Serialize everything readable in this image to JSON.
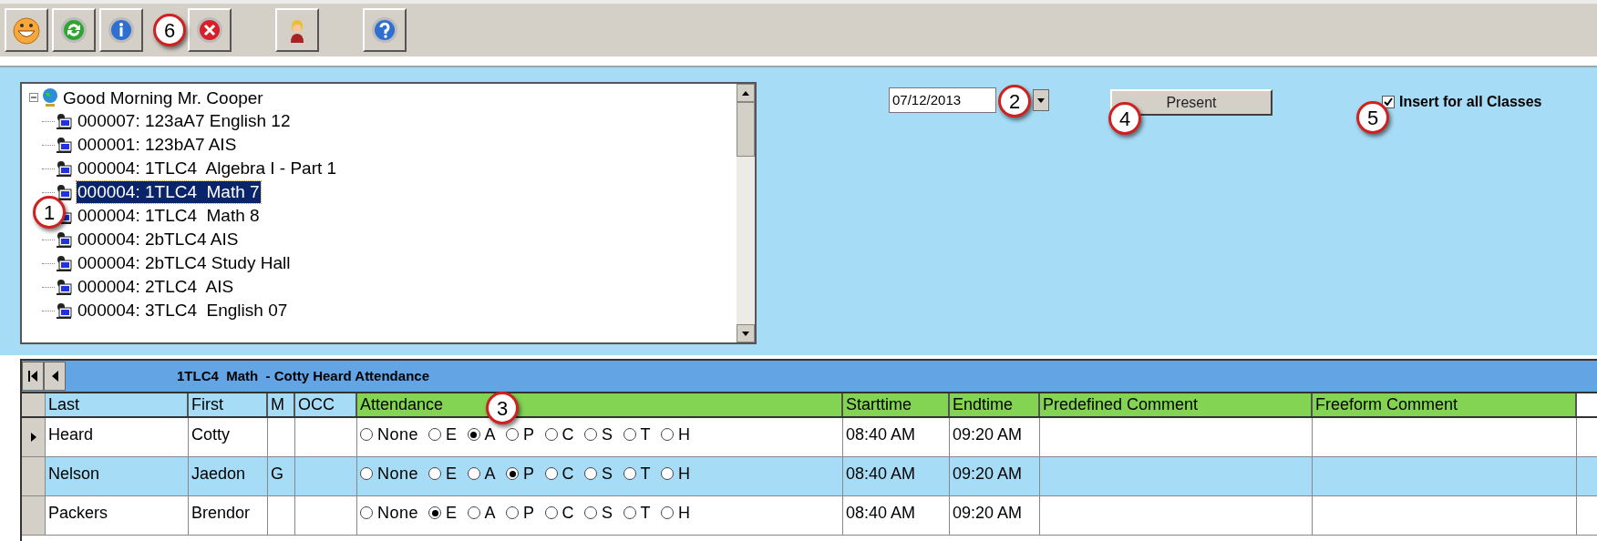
{
  "toolbar": {
    "buttons": [
      {
        "kind": "smiley"
      },
      {
        "kind": "refresh"
      },
      {
        "kind": "info"
      },
      {
        "kind": "close"
      },
      {
        "kind": "person"
      },
      {
        "kind": "help"
      }
    ]
  },
  "tree": {
    "root": {
      "label": "Good Morning Mr. Cooper",
      "expanded": true,
      "children": [
        {
          "label": "000007: 123aA7 English 12",
          "selected": false
        },
        {
          "label": "000001: 123bA7 AIS",
          "selected": false
        },
        {
          "label": "000004: 1TLC4  Algebra I - Part 1",
          "selected": false
        },
        {
          "label": "000004: 1TLC4  Math 7",
          "selected": true
        },
        {
          "label": "000004: 1TLC4  Math 8",
          "selected": false
        },
        {
          "label": "000004: 2bTLC4 AIS",
          "selected": false
        },
        {
          "label": "000004: 2bTLC4 Study Hall",
          "selected": false
        },
        {
          "label": "000004: 2TLC4  AIS",
          "selected": false
        },
        {
          "label": "000004: 3TLC4  English 07",
          "selected": false
        }
      ]
    }
  },
  "date_field": {
    "value": "07/12/2013"
  },
  "present_button": {
    "label": "Present"
  },
  "insert_all": {
    "label": "Insert for all Classes",
    "checked": true
  },
  "grid": {
    "title": "1TLC4  Math  - Cotty Heard Attendance",
    "columns": [
      "Last",
      "First",
      "M",
      "OCC",
      "Attendance",
      "Starttime",
      "Endtime",
      "Predefined Comment",
      "Freeform Comment"
    ],
    "rows": [
      {
        "current": true,
        "last": "Heard",
        "first": "Cotty",
        "attendance": [
          {
            "label": "None",
            "selected": false
          },
          {
            "label": "E",
            "selected": false
          },
          {
            "label": "A",
            "selected": true
          },
          {
            "label": "P",
            "selected": false
          },
          {
            "label": "C",
            "selected": false
          },
          {
            "label": "S",
            "selected": false
          },
          {
            "label": "T",
            "selected": false
          },
          {
            "label": "H",
            "selected": false
          }
        ],
        "start": "08:40 AM",
        "end": "09:20 AM"
      },
      {
        "current": false,
        "last": "Nelson",
        "first": "Jaedon",
        "m": "G",
        "attendance": [
          {
            "label": "None",
            "selected": false
          },
          {
            "label": "E",
            "selected": false
          },
          {
            "label": "A",
            "selected": false
          },
          {
            "label": "P",
            "selected": true
          },
          {
            "label": "C",
            "selected": false
          },
          {
            "label": "S",
            "selected": false
          },
          {
            "label": "T",
            "selected": false
          },
          {
            "label": "H",
            "selected": false
          }
        ],
        "start": "08:40 AM",
        "end": "09:20 AM"
      },
      {
        "current": false,
        "last": "Packers",
        "first": "Brendor",
        "attendance": [
          {
            "label": "None",
            "selected": false
          },
          {
            "label": "E",
            "selected": true
          },
          {
            "label": "A",
            "selected": false
          },
          {
            "label": "P",
            "selected": false
          },
          {
            "label": "C",
            "selected": false
          },
          {
            "label": "S",
            "selected": false
          },
          {
            "label": "T",
            "selected": false
          },
          {
            "label": "H",
            "selected": false
          }
        ],
        "start": "08:40 AM",
        "end": "09:20 AM"
      }
    ]
  },
  "callouts": [
    {
      "label": "1"
    },
    {
      "label": "2"
    },
    {
      "label": "3"
    },
    {
      "label": "4"
    },
    {
      "label": "5"
    },
    {
      "label": "6"
    }
  ]
}
